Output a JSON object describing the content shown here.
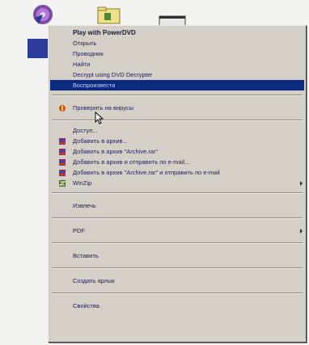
{
  "context_menu": {
    "items": [
      {
        "label": "Play with PowerDVD",
        "bold": true
      },
      {
        "label": "Открыть"
      },
      {
        "label": "Проводник"
      },
      {
        "label": "Найти"
      },
      {
        "label": "Decrypt using DVD Decrypter"
      },
      {
        "label": "Воспроизвести",
        "highlighted": true
      },
      {
        "label": "Проверить на вирусы",
        "icon": "antivirus-icon"
      },
      {
        "label": "Доступ..."
      },
      {
        "label": "Добавить в архив...",
        "icon": "winrar-archive-icon"
      },
      {
        "label": "Добавить в архив \"Archive.rar\"",
        "icon": "winrar-archive-icon"
      },
      {
        "label": "Добавить в архив и отправить по e-mail...",
        "icon": "winrar-archive-icon"
      },
      {
        "label": "Добавить в архив \"Archive.rar\" и отправить по e-mail",
        "icon": "winrar-archive-icon"
      },
      {
        "label": "WinZip",
        "icon": "winzip-icon",
        "submenu": true
      },
      {
        "label": "Извлечь"
      },
      {
        "label": "PDF",
        "submenu": true
      },
      {
        "label": "Вставить"
      },
      {
        "label": "Создать ярлык"
      },
      {
        "label": "Свойства"
      }
    ]
  },
  "colors": {
    "menu_background": "#d4d0c8",
    "highlight": "#0b2a80",
    "text": "#1f1f55"
  }
}
